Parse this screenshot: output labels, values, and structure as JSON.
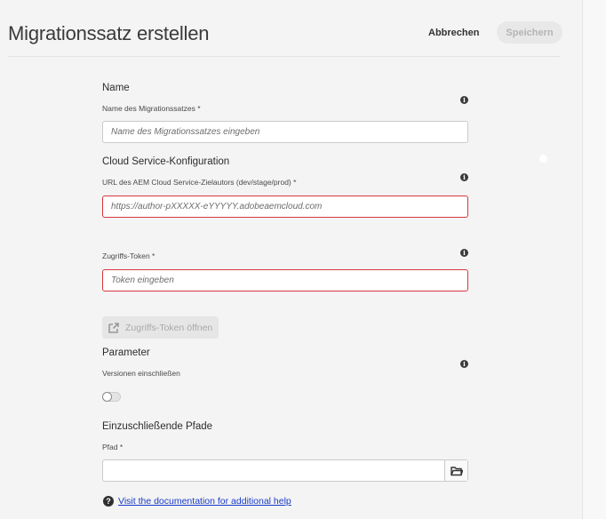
{
  "header": {
    "title": "Migrationssatz erstellen",
    "cancel_label": "Abbrechen",
    "save_label": "Speichern"
  },
  "name_section": {
    "title": "Name",
    "field_label": "Name des Migrationssatzes *",
    "placeholder": "Name des Migrationssatzes eingeben",
    "value": ""
  },
  "cloud_section": {
    "title": "Cloud Service-Konfiguration",
    "url_label": "URL des AEM Cloud Service-Zielautors (dev/stage/prod) *",
    "url_placeholder": "https://author-pXXXXX-eYYYYY.adobeaemcloud.com",
    "token_label": "Zugriffs-Token *",
    "token_placeholder": "Token eingeben",
    "open_token_label": "Zugriffs-Token öffnen"
  },
  "parameter_section": {
    "title": "Parameter",
    "versions_label": "Versionen einschließen",
    "versions_enabled": false
  },
  "paths_section": {
    "title": "Einzuschließende Pfade",
    "path_label": "Pfad *",
    "path_value": ""
  },
  "help": {
    "link_text": "Visit the documentation for additional help"
  },
  "icons": {
    "info": "info-icon",
    "external_link": "external-link-icon",
    "folder": "folder-icon",
    "help": "help-icon"
  },
  "colors": {
    "error_border": "#d7373f",
    "link": "#1a3bc8",
    "disabled_text": "#b4b4b4"
  }
}
